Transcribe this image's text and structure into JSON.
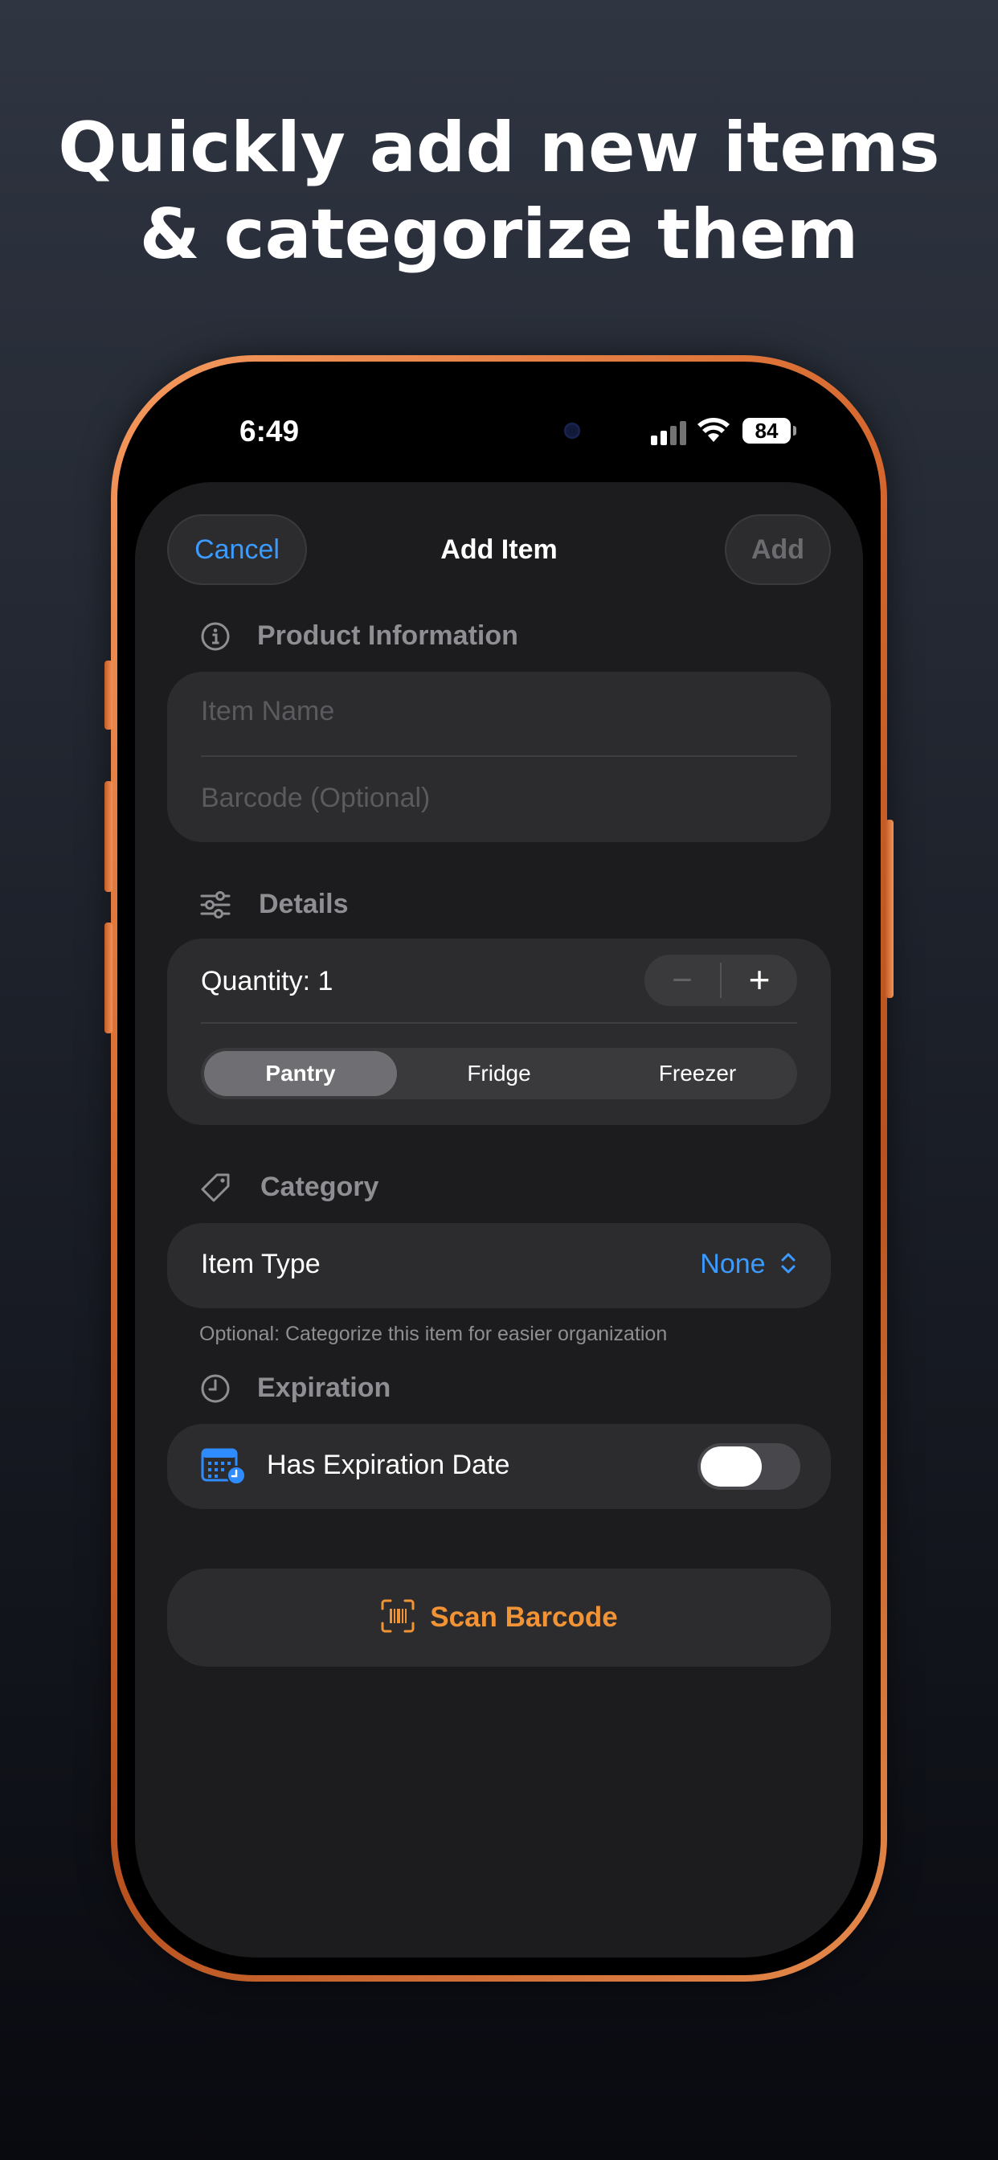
{
  "headline": {
    "line1": "Quickly add new items",
    "line2": "& categorize them"
  },
  "status_bar": {
    "time": "6:49",
    "battery": "84"
  },
  "nav": {
    "cancel_label": "Cancel",
    "title": "Add Item",
    "add_label": "Add"
  },
  "product_info": {
    "header": "Product Information",
    "item_name_placeholder": "Item Name",
    "barcode_placeholder": "Barcode (Optional)"
  },
  "details": {
    "header": "Details",
    "quantity_label": "Quantity: 1",
    "stepper_minus": "−",
    "stepper_plus": "+",
    "locations": [
      {
        "label": "Pantry",
        "selected": true
      },
      {
        "label": "Fridge",
        "selected": false
      },
      {
        "label": "Freezer",
        "selected": false
      }
    ]
  },
  "category": {
    "header": "Category",
    "item_type_label": "Item Type",
    "item_type_value": "None",
    "hint": "Optional: Categorize this item for easier organization"
  },
  "expiration": {
    "header": "Expiration",
    "toggle_label": "Has Expiration Date",
    "toggle_on": false
  },
  "scan": {
    "label": "Scan Barcode"
  },
  "colors": {
    "accent_blue": "#3b9bff",
    "accent_orange": "#f29436",
    "frame": "#d6682f"
  }
}
